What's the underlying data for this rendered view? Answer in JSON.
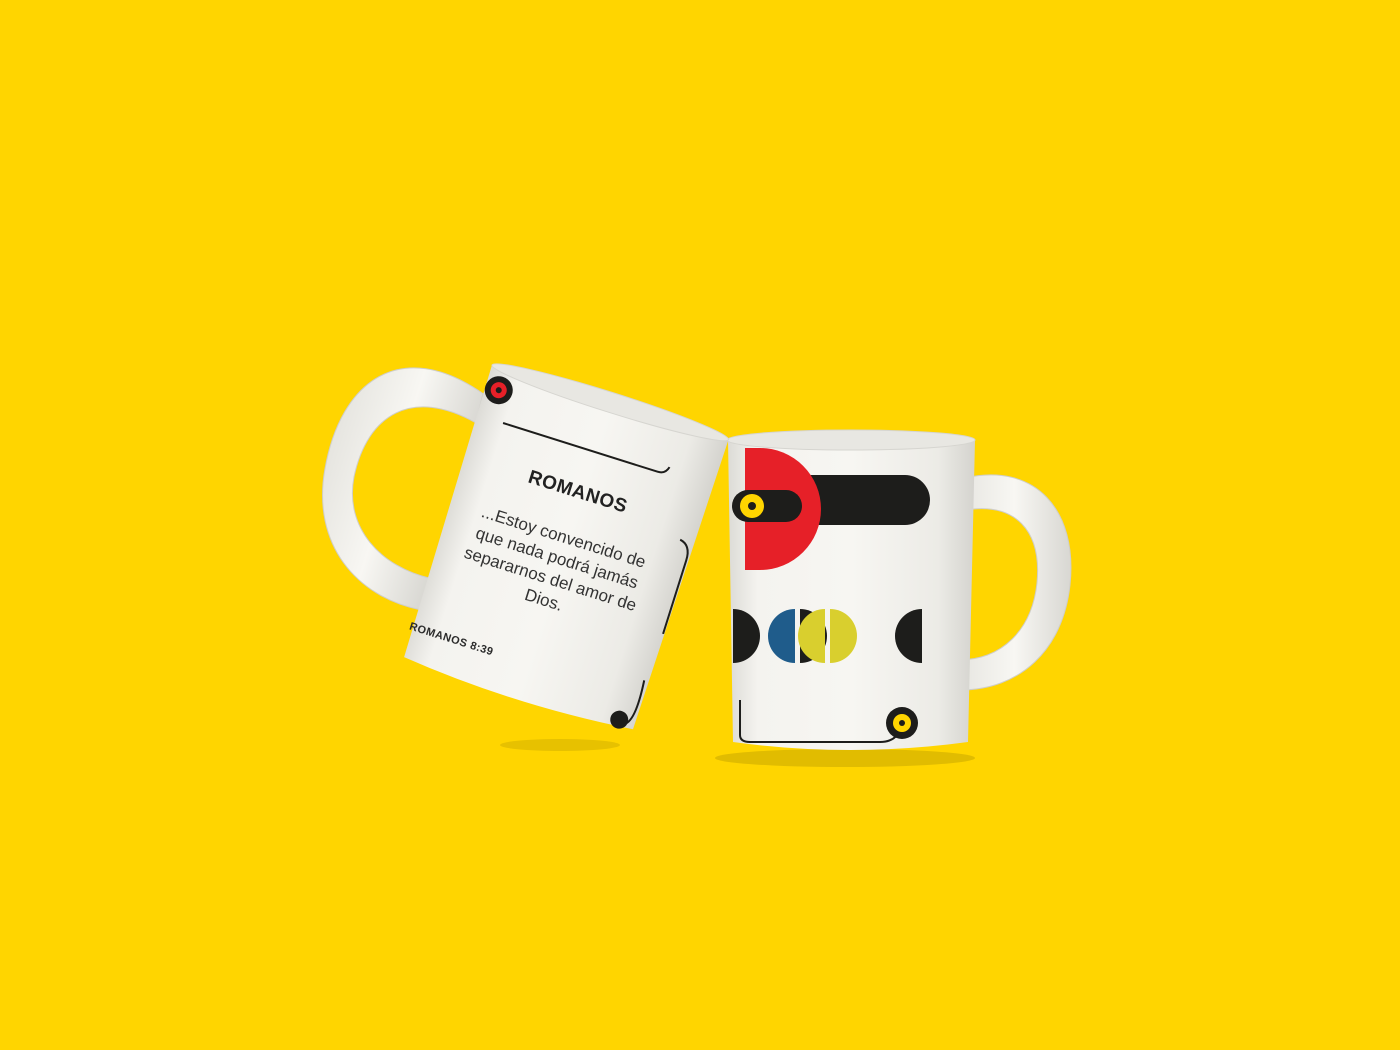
{
  "scene": {
    "background_color": "#FFD500",
    "mug_color": "#F1F0EC"
  },
  "tilted_mug": {
    "title": "ROMANOS",
    "verse": "...Estoy convencido de que nada podrá jamás separarnos del amor de Dios.",
    "reference": "ROMANOS 8:39"
  },
  "upright_mug": {
    "print_colors": [
      "#E62028",
      "#FFD500",
      "#1D1D1B",
      "#1F5C8B",
      "#D9CF2E"
    ]
  }
}
